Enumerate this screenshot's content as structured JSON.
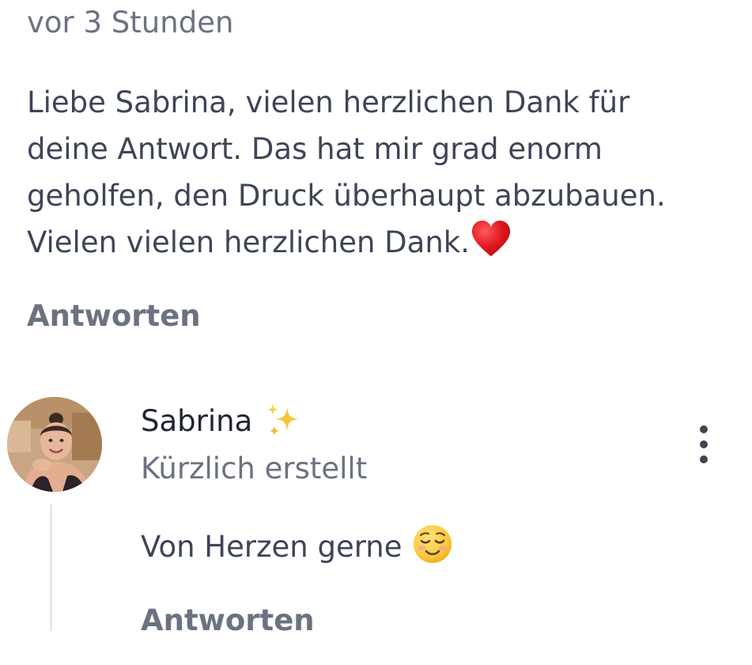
{
  "comment": {
    "timestamp": "vor 3 Stunden",
    "text_lines": [
      "Liebe Sabrina, vielen herzlichen Dank für",
      "deine Antwort. Das hat mir grad enorm",
      "geholfen, den Druck überhaupt abzubauen.",
      "Vielen vielen herzlichen Dank."
    ],
    "trailing_emoji": "heart-icon",
    "reply_label": "Antworten"
  },
  "reply": {
    "author": "Sabrina",
    "author_badge_icon": "sparkles-icon",
    "created_label": "Kürzlich erstellt",
    "text": "Von Herzen gerne",
    "trailing_emoji": "smiling-face-icon",
    "reply_label": "Antworten",
    "menu_icon": "more-vertical-icon"
  },
  "colors": {
    "body_text": "#3d4556",
    "muted_text": "#6b7280",
    "author_text": "#1f2433",
    "thread_line": "#e5e7eb",
    "heart": "#e0171f"
  }
}
